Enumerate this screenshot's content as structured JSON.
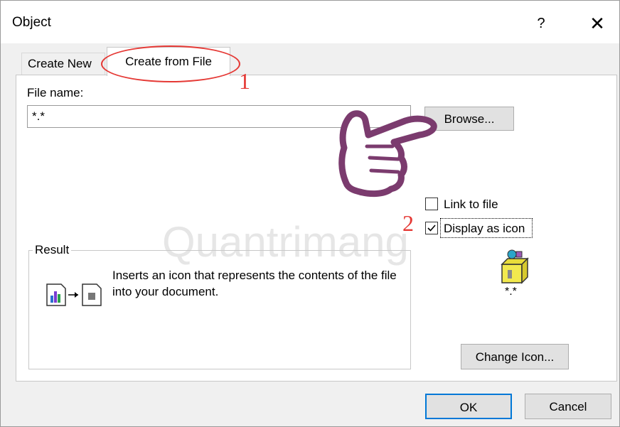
{
  "dialog": {
    "title": "Object",
    "help_label": "?",
    "close_label": "✕"
  },
  "tabs": [
    {
      "label": "Create New",
      "active": false
    },
    {
      "label": "Create from File",
      "active": true
    }
  ],
  "annotations": {
    "step1": "1",
    "step2": "2"
  },
  "file": {
    "label": "File name:",
    "value": "*.*",
    "browse_label": "Browse..."
  },
  "options": {
    "link_label": "Link to file",
    "link_checked": false,
    "display_label": "Display as icon",
    "display_checked": true
  },
  "result": {
    "legend": "Result",
    "text": "Inserts an icon that represents the contents of the file into your document."
  },
  "icon_preview": {
    "caption": "*.*",
    "icon": "package-icon"
  },
  "change_icon_label": "Change Icon...",
  "buttons": {
    "ok": "OK",
    "cancel": "Cancel"
  },
  "watermark": "Quantrimang",
  "colors": {
    "annotation_red": "#e53935",
    "default_button_border": "#0078d7",
    "hand_purple": "#7b3b6e"
  }
}
